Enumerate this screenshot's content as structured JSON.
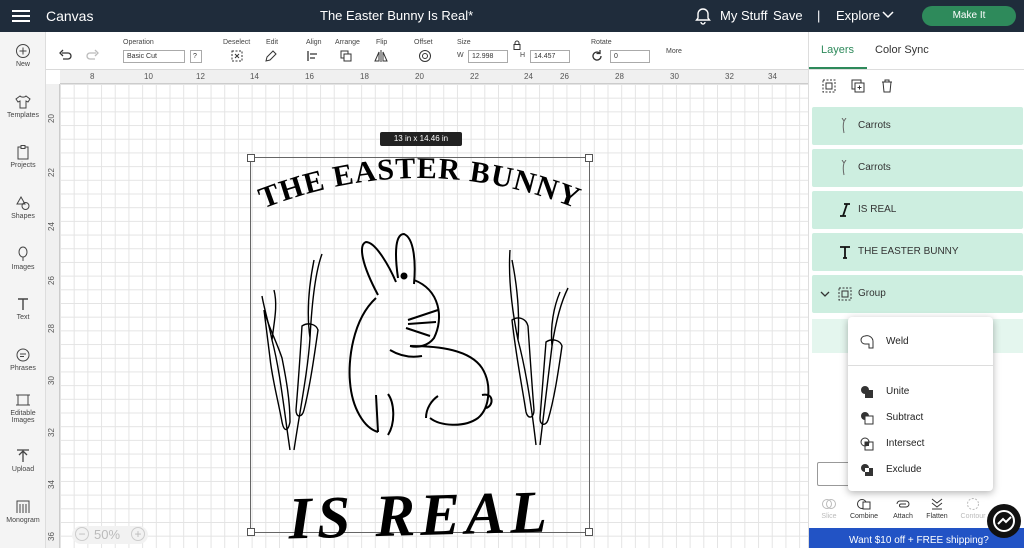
{
  "topbar": {
    "app_title": "Canvas",
    "doc_title": "The Easter Bunny Is Real*",
    "my_stuff": "My Stuff",
    "save": "Save",
    "separator": "|",
    "explore": "Explore",
    "make_it": "Make It"
  },
  "toolbar": {
    "operation_label": "Operation",
    "operation_value": "Basic Cut",
    "help": "?",
    "deselect_label": "Deselect",
    "edit_label": "Edit",
    "align_label": "Align",
    "arrange_label": "Arrange",
    "flip_label": "Flip",
    "offset_label": "Offset",
    "size_label": "Size",
    "w_label": "W",
    "w_value": "12.998",
    "h_label": "H",
    "h_value": "14.457",
    "rotate_label": "Rotate",
    "rotate_value": "0",
    "more": "More"
  },
  "left_nav": [
    "New",
    "Templates",
    "Projects",
    "Shapes",
    "Images",
    "Text",
    "Phrases",
    "Editable Images",
    "Upload",
    "Monogram"
  ],
  "ruler_top": [
    "8",
    "10",
    "12",
    "14",
    "16",
    "18",
    "20",
    "22",
    "24",
    "26",
    "28",
    "30",
    "32",
    "34"
  ],
  "ruler_left": [
    "20",
    "22",
    "24",
    "26",
    "28",
    "30",
    "32",
    "34",
    "36"
  ],
  "canvas": {
    "size_tag": "13  in x 14.46  in",
    "top_text": "THE EASTER BUNNY",
    "bottom_text": "IS REAL",
    "zoom_out": "−",
    "zoom": "50%",
    "zoom_in": "+"
  },
  "right_panel": {
    "tab_layers": "Layers",
    "tab_color_sync": "Color Sync",
    "layers": [
      {
        "label": "Carrots",
        "icon": "carrot-icon"
      },
      {
        "label": "Carrots",
        "icon": "carrot-icon"
      },
      {
        "label": "IS REAL",
        "icon": "text-italic-icon"
      },
      {
        "label": "THE EASTER BUNNY",
        "icon": "text-icon"
      },
      {
        "label": "Group",
        "icon": "group-icon"
      }
    ],
    "bottom_actions": [
      "Slice",
      "Combine",
      "Attach",
      "Flatten",
      "Contour"
    ],
    "promo": "Want $10 off + FREE shipping?"
  },
  "combine_menu": {
    "items": [
      "Weld",
      "Unite",
      "Subtract",
      "Intersect",
      "Exclude"
    ]
  },
  "colors": {
    "topbar_bg": "#1f2c3b",
    "make_it_green": "#2e8a5b",
    "layer_highlight": "#cdeee0",
    "promo_blue": "#2253c5"
  }
}
